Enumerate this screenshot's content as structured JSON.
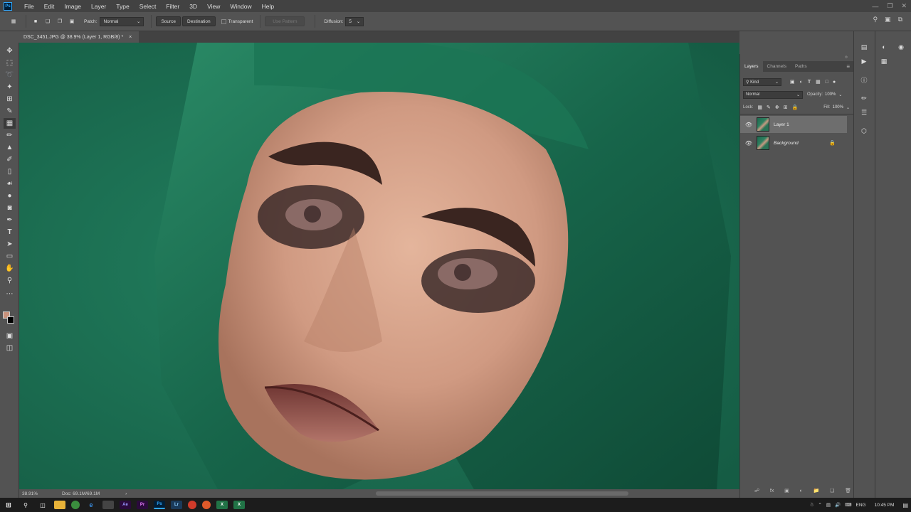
{
  "app": {
    "logo": "Ps"
  },
  "menu": [
    "File",
    "Edit",
    "Image",
    "Layer",
    "Type",
    "Select",
    "Filter",
    "3D",
    "View",
    "Window",
    "Help"
  ],
  "window_controls": [
    "minimize-icon",
    "restore-icon",
    "close-icon"
  ],
  "options": {
    "patch_label": "Patch:",
    "patch_value": "Normal",
    "source_label": "Source",
    "destination_label": "Destination",
    "transparent_label": "Transparent",
    "use_pattern_label": "Use Pattern",
    "diffusion_label": "Diffusion:",
    "diffusion_value": "5"
  },
  "document": {
    "tab_title": "DSC_3451.JPG @ 38.9% (Layer 1, RGB/8) *",
    "close": "×"
  },
  "status": {
    "zoom": "38.91%",
    "doc_info": "Doc: 69.1M/69.1M",
    "arrow": "›"
  },
  "panel": {
    "tabs": [
      "Layers",
      "Channels",
      "Paths"
    ],
    "kind_label": "Kind",
    "blend_mode": "Normal",
    "opacity_label": "Opacity:",
    "opacity_value": "100%",
    "lock_label": "Lock:",
    "fill_label": "Fill:",
    "fill_value": "100%",
    "layers": [
      {
        "name": "Layer 1",
        "visible": true,
        "selected": true,
        "locked": false
      },
      {
        "name": "Background",
        "visible": true,
        "selected": false,
        "locked": true
      }
    ]
  },
  "tray": {
    "language": "ENG",
    "time": "10:45 PM"
  },
  "colors": {
    "canvas_bg": "#1e7257",
    "scarf": "#17654a",
    "skin": "#d09a82",
    "lips": "#8a4a45",
    "foreground_swatch": "#c8927c",
    "background_swatch": "#000000"
  }
}
